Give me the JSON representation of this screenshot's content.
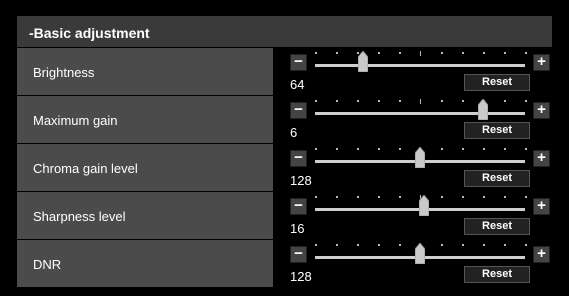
{
  "section": {
    "title": "-Basic adjustment"
  },
  "controls": [
    {
      "label": "Brightness",
      "value": "64",
      "position": 0.23,
      "minus": "−",
      "plus": "+",
      "reset": "Reset"
    },
    {
      "label": "Maximum gain",
      "value": "6",
      "position": 0.8,
      "minus": "−",
      "plus": "+",
      "reset": "Reset"
    },
    {
      "label": "Chroma gain level",
      "value": "128",
      "position": 0.5,
      "minus": "−",
      "plus": "+",
      "reset": "Reset"
    },
    {
      "label": "Sharpness level",
      "value": "16",
      "position": 0.52,
      "minus": "−",
      "plus": "+",
      "reset": "Reset"
    },
    {
      "label": "DNR",
      "value": "128",
      "position": 0.5,
      "minus": "−",
      "plus": "+",
      "reset": "Reset"
    }
  ],
  "colors": {
    "header_bg": "#3a3a3a",
    "label_bg": "#4b4b4b",
    "track": "#cfcfcf",
    "thumb": "#c9c9c9"
  }
}
